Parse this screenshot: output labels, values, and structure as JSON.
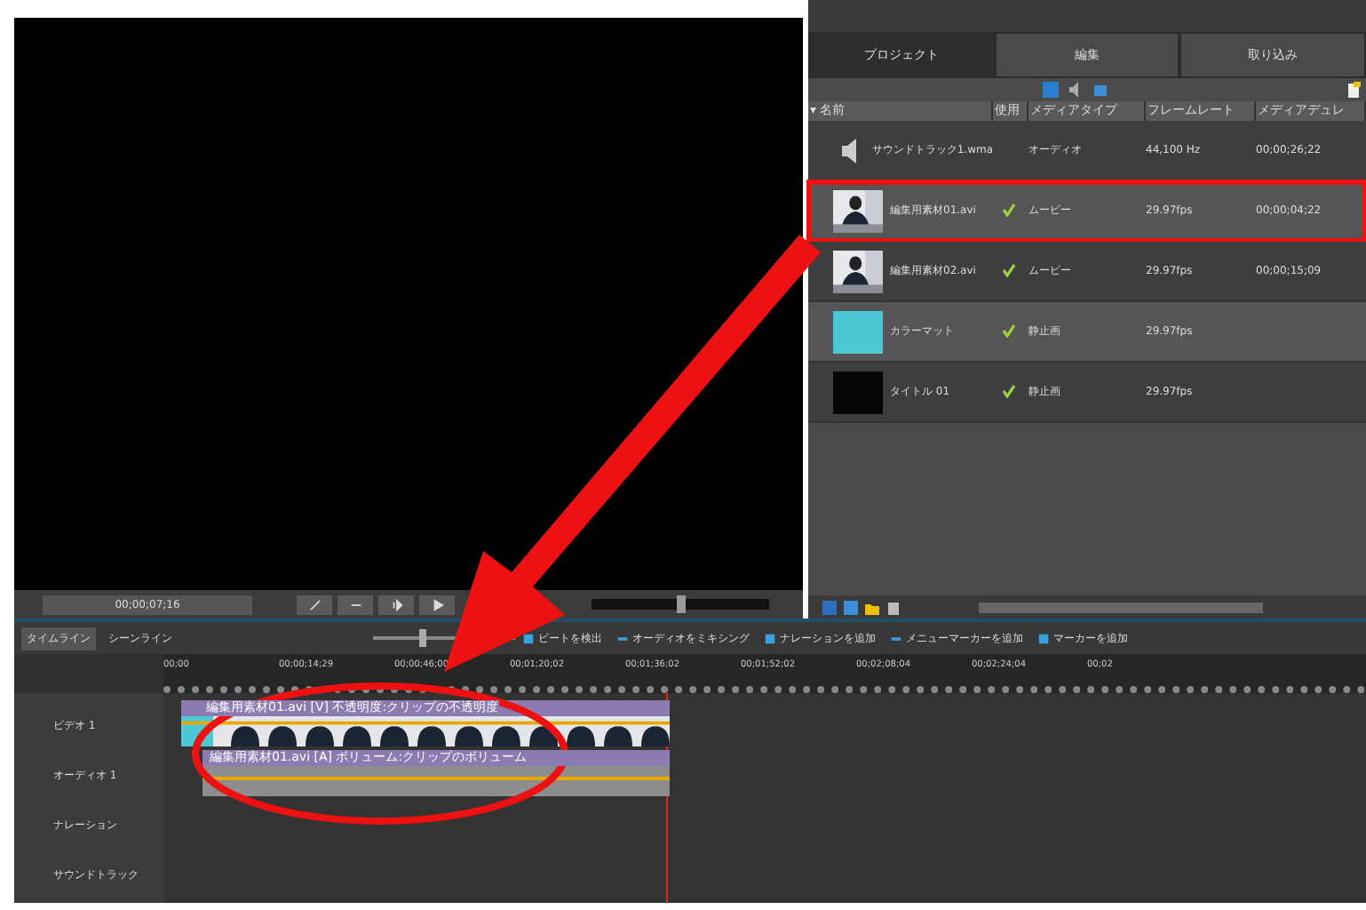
{
  "monitor": {
    "timecode": "00;00;07;16",
    "volume": {
      "level": 0.5
    }
  },
  "project_tabs": [
    {
      "label": "プロジェクト",
      "selected": true
    },
    {
      "label": "編集",
      "selected": false
    },
    {
      "label": "取り込み",
      "selected": false
    }
  ],
  "media_table": {
    "columns": [
      "▾ 名前",
      "使用",
      "メディアタイプ",
      "フレームレート",
      "メディアデュレ"
    ],
    "rows": [
      {
        "kind": "audio",
        "name": "サウンドトラック1.wma",
        "used": false,
        "media_type": "オーディオ",
        "frame_rate": "44,100 Hz",
        "duration": "00;00;26;22",
        "highlighted": false
      },
      {
        "kind": "video",
        "name": "編集用素材01.avi",
        "used": true,
        "media_type": "ムービー",
        "frame_rate": "29.97fps",
        "duration": "00;00;04;22",
        "highlighted": true
      },
      {
        "kind": "video",
        "name": "編集用素材02.avi",
        "used": true,
        "media_type": "ムービー",
        "frame_rate": "29.97fps",
        "duration": "00;00;15;09",
        "highlighted": false
      },
      {
        "kind": "matte",
        "name": "カラーマット",
        "used": true,
        "media_type": "静止画",
        "frame_rate": "29.97fps",
        "highlighted": false
      },
      {
        "kind": "title",
        "name": "タイトル 01",
        "used": true,
        "media_type": "静止画",
        "frame_rate": "29.97fps",
        "highlighted": false
      }
    ]
  },
  "timeline": {
    "tabs": [
      {
        "label": "タイムライン",
        "selected": true
      },
      {
        "label": "シーンライン",
        "selected": false
      }
    ],
    "zoom": {
      "level": 0.35
    },
    "actions": [
      "ビートを検出",
      "オーディオをミキシング",
      "ナレーションを追加",
      "メニューマーカーを追加",
      "マーカーを追加"
    ],
    "ruler": [
      "00;00",
      "00;00;14;29",
      "00;00;46;00",
      "00;01;20;02",
      "00;01;36;02",
      "00;01;52;02",
      "00;02;08;04",
      "00;02;24;04",
      "00;02"
    ],
    "tracks": [
      {
        "name": "ビデオ 1",
        "kind": "video"
      },
      {
        "name": "オーディオ 1",
        "kind": "audio"
      },
      {
        "name": "ナレーション",
        "kind": "empty"
      },
      {
        "name": "サウンドトラック",
        "kind": "empty"
      }
    ],
    "video_clip_label": "編集用素材01.avi [V] 不透明度:クリップの不透明度",
    "audio_clip_label": "編集用素材01.avi [A] ボリューム:クリップのボリューム"
  }
}
